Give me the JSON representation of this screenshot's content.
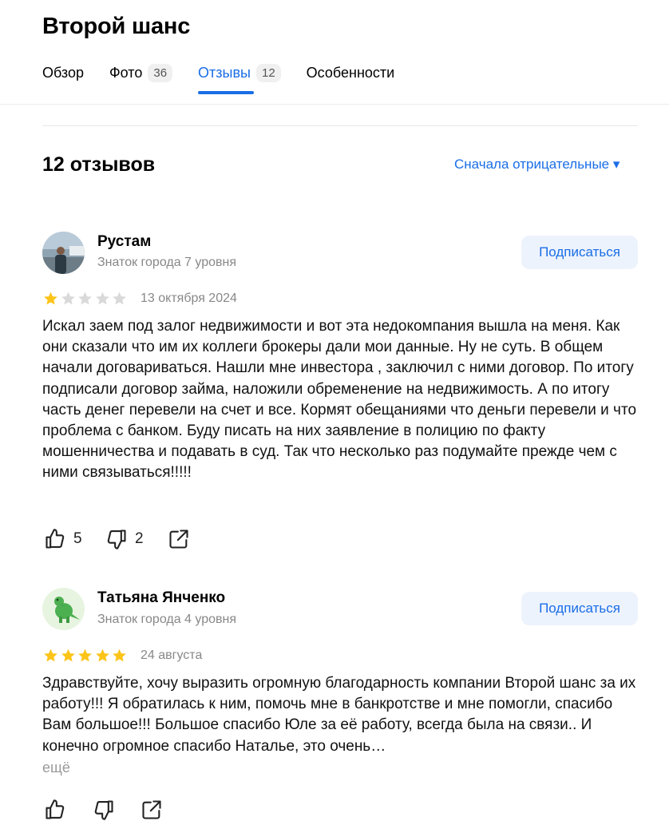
{
  "header": {
    "title": "Второй шанс",
    "tabs": [
      {
        "label": "Обзор",
        "count": ""
      },
      {
        "label": "Фото",
        "count": "36"
      },
      {
        "label": "Отзывы",
        "count": "12"
      },
      {
        "label": "Особенности",
        "count": ""
      }
    ],
    "active_tab": "Отзывы"
  },
  "reviews_header": {
    "count_label": "12 отзывов",
    "sort_label": "Сначала отрицательные ▾"
  },
  "reviews": [
    {
      "author": "Рустам",
      "level": "Знаток города 7 уровня",
      "subscribe_label": "Подписаться",
      "rating": 1,
      "date": "13 октября 2024",
      "text": "Искал заем под залог недвижимости и вот эта недокомпания вышла на меня. Как они сказали что им их коллеги брокеры дали мои данные. Ну не суть. В общем начали договариваться. Нашли мне инвестора , заключил с ними договор. По итогу подписали договор займа, наложили обременение на недвижимость. А по итогу часть денег перевели на счет и все. Кормят обещаниями что деньги перевели и что проблема с банком. Буду писать на них заявление в полицию по факту мошенничества и подавать в суд. Так что несколько раз подумайте прежде чем с ними связываться!!!!!",
      "likes": "5",
      "dislikes": "2"
    },
    {
      "author": "Татьяна Янченко",
      "level": "Знаток города 4 уровня",
      "subscribe_label": "Подписаться",
      "rating": 5,
      "date": "24 августа",
      "text": "Здравствуйте, хочу выразить огромную благодарность компании Второй шанс за их работу!!! Я обратилась к ним, помочь мне в банкротстве и мне помогли, спасибо Вам большое!!! Большое спасибо Юле за её работу, всегда была на связи.. И конечно огромное спасибо Наталье, это очень…",
      "more_label": "ещё",
      "likes": "",
      "dislikes": ""
    }
  ],
  "colors": {
    "accent": "#1a6ee6",
    "star_filled": "#fcc419",
    "star_empty": "#d9d9d9"
  },
  "icons": [
    "thumb-up-icon",
    "thumb-down-icon",
    "share-icon",
    "dinosaur-avatar-icon"
  ]
}
